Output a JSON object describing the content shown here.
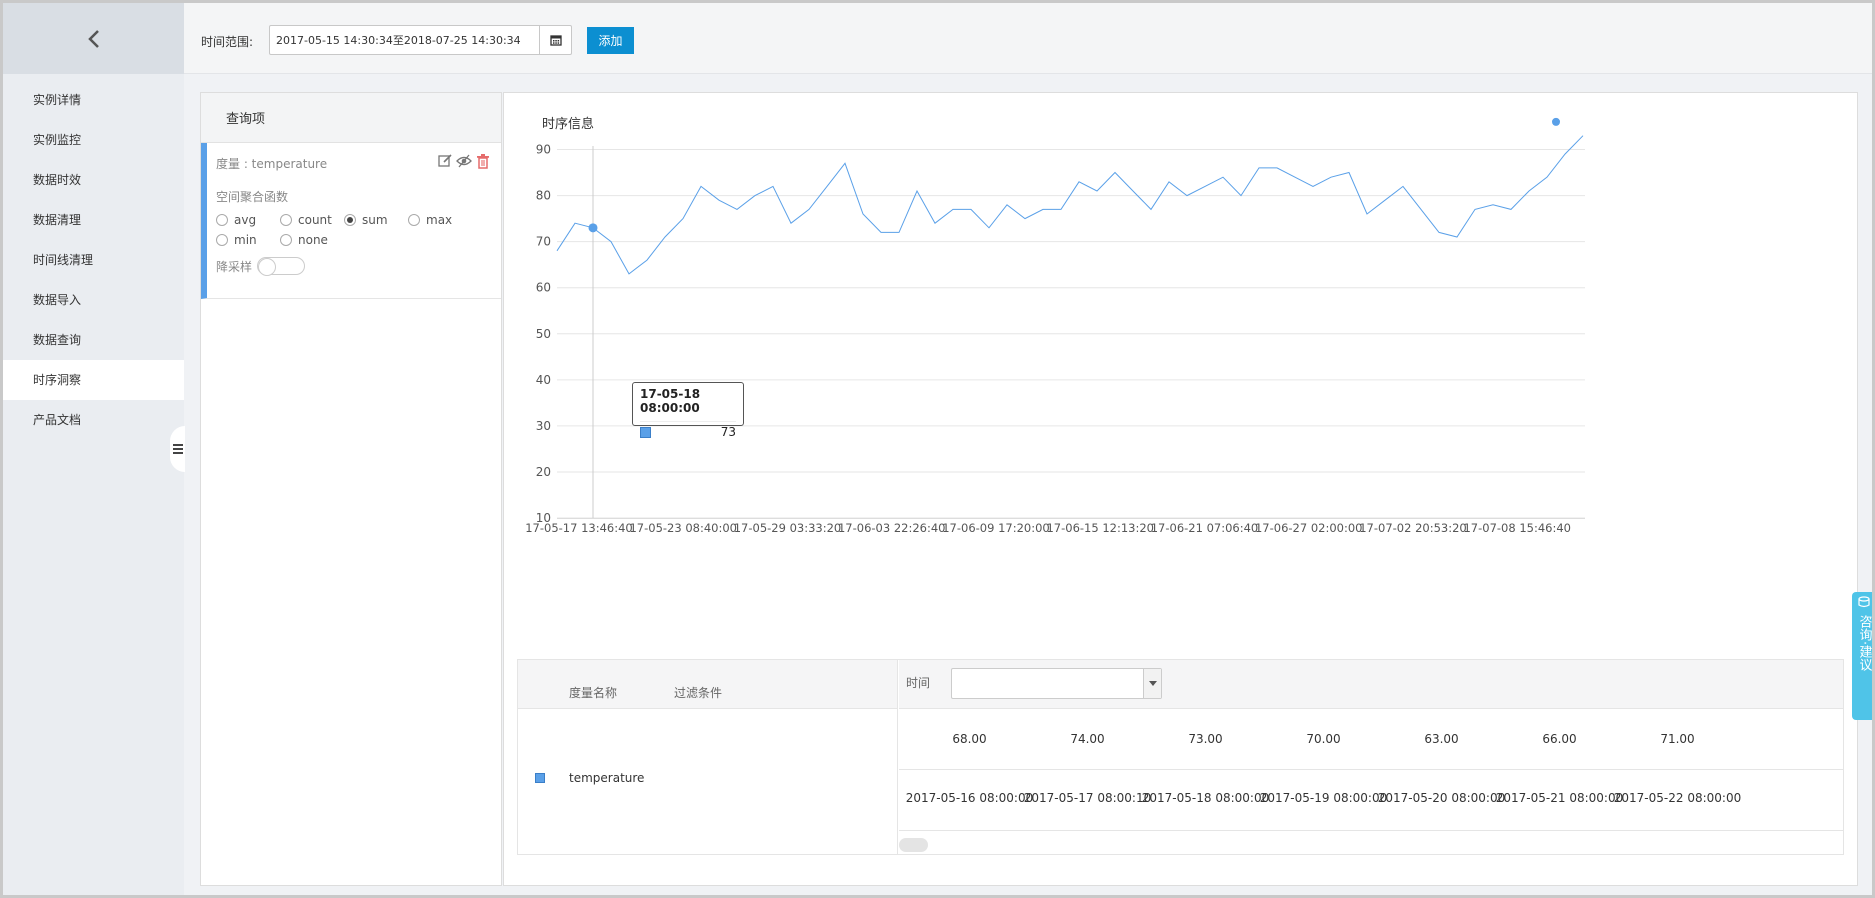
{
  "sidebar": {
    "back_icon": "chevron-left-icon",
    "items": [
      {
        "label": "实例详情"
      },
      {
        "label": "实例监控"
      },
      {
        "label": "数据时效"
      },
      {
        "label": "数据清理"
      },
      {
        "label": "时间线清理"
      },
      {
        "label": "数据导入"
      },
      {
        "label": "数据查询"
      },
      {
        "label": "时序洞察",
        "active": true
      },
      {
        "label": "产品文档"
      }
    ],
    "collapse_icon": "menu-icon"
  },
  "topbar": {
    "time_range_label": "时间范围:",
    "time_range_value": "2017-05-15 14:30:34至2018-07-25 14:30:34",
    "calendar_icon": "calendar-icon",
    "add_label": "添加",
    "accent": "#0c8fd1"
  },
  "query_panel": {
    "title": "查询项",
    "item": {
      "metric_label": "度量 : temperature",
      "actions": [
        "edit-icon",
        "hide-icon",
        "delete-icon"
      ],
      "agg_label": "空间聚合函数",
      "agg_options": [
        "avg",
        "count",
        "sum",
        "max",
        "min",
        "none"
      ],
      "agg_selected": "sum",
      "downsample_label": "降采样",
      "downsample_on": false
    }
  },
  "chart_panel": {
    "title": "时序信息",
    "tooltip": {
      "time": "17-05-18 08:00:00",
      "value": "73"
    }
  },
  "chart_data": {
    "type": "line",
    "title": "",
    "xlabel": "",
    "ylabel": "",
    "ylim": [
      10,
      95
    ],
    "yticks": [
      10,
      20,
      30,
      40,
      50,
      60,
      70,
      80,
      90
    ],
    "x_tick_labels": [
      "17-05-17 13:46:40",
      "17-05-23 08:40:00",
      "17-05-29 03:33:20",
      "17-06-03 22:26:40",
      "17-06-09 17:20:00",
      "17-06-15 12:13:20",
      "17-06-21 07:06:40",
      "17-06-27 02:00:00",
      "17-07-02 20:53:20",
      "17-07-08 15:46:40"
    ],
    "grid": true,
    "legend": "none",
    "color": "#5aa0e8",
    "series": [
      {
        "name": "temperature",
        "x": [
          "2017-05-16",
          "2017-05-17",
          "2017-05-18",
          "2017-05-19",
          "2017-05-20",
          "2017-05-21",
          "2017-05-22",
          "2017-05-23",
          "2017-05-24",
          "2017-05-25",
          "2017-05-26",
          "2017-05-27",
          "2017-05-28",
          "2017-05-29",
          "2017-05-30",
          "2017-05-31",
          "2017-06-01",
          "2017-06-02",
          "2017-06-03",
          "2017-06-04",
          "2017-06-05",
          "2017-06-06",
          "2017-06-07",
          "2017-06-08",
          "2017-06-09",
          "2017-06-10",
          "2017-06-11",
          "2017-06-12",
          "2017-06-13",
          "2017-06-14",
          "2017-06-15",
          "2017-06-16",
          "2017-06-17",
          "2017-06-18",
          "2017-06-19",
          "2017-06-20",
          "2017-06-21",
          "2017-06-22",
          "2017-06-23",
          "2017-06-24",
          "2017-06-25",
          "2017-06-26",
          "2017-06-27",
          "2017-06-28",
          "2017-06-29",
          "2017-06-30",
          "2017-07-01",
          "2017-07-02",
          "2017-07-03",
          "2017-07-04",
          "2017-07-05",
          "2017-07-06",
          "2017-07-07",
          "2017-07-08",
          "2017-07-09",
          "2017-07-10",
          "2017-07-11",
          "2017-07-12"
        ],
        "values": [
          68,
          74,
          73,
          70,
          63,
          66,
          71,
          75,
          82,
          79,
          77,
          80,
          82,
          74,
          77,
          82,
          87,
          76,
          72,
          72,
          81,
          74,
          77,
          77,
          73,
          78,
          75,
          77,
          77,
          83,
          81,
          85,
          81,
          77,
          83,
          80,
          82,
          84,
          80,
          86,
          86,
          84,
          82,
          84,
          85,
          76,
          79,
          82,
          77,
          72,
          71,
          77,
          78,
          77,
          81,
          84,
          89,
          93
        ]
      }
    ],
    "marker_dot_value": 96
  },
  "data_table": {
    "headers": {
      "metric": "度量名称",
      "filter": "过滤条件",
      "time": "时间"
    },
    "row_name": "temperature",
    "time_select_value": "",
    "values": [
      "68.00",
      "74.00",
      "73.00",
      "70.00",
      "63.00",
      "66.00",
      "71.00"
    ],
    "timestamps": [
      "2017-05-16 08:00:00",
      "2017-05-17 08:00:10",
      "2017-05-18 08:00:00",
      "2017-05-19 08:00:00",
      "2017-05-20 08:00:00",
      "2017-05-21 08:00:00",
      "2017-05-22 08:00:00"
    ]
  },
  "consult": {
    "label": "咨询·建议",
    "icon": "chat-icon",
    "color": "#4fc4e8"
  }
}
